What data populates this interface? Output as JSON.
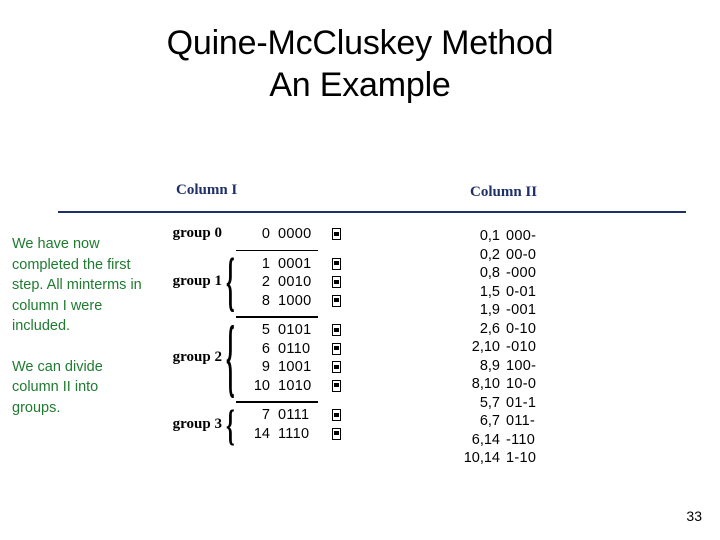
{
  "slide": {
    "title_line1": "Quine-McCluskey Method",
    "title_line2": "An Example",
    "page_number": "33"
  },
  "commentary": {
    "paragraph1": "We have now completed the first step. All minterms in column I were included.",
    "paragraph2": "We can divide column II into groups.",
    "color": "#1E7B30"
  },
  "headers": {
    "column1": "Column I",
    "column2": "Column II",
    "color": "#1F3068"
  },
  "column1": {
    "groups": [
      {
        "label": "group 0",
        "rows": [
          {
            "minterm": "0",
            "bits": "0000",
            "mark": "check-box-icon"
          }
        ]
      },
      {
        "label": "group 1",
        "rows": [
          {
            "minterm": "1",
            "bits": "0001",
            "mark": "check-box-icon"
          },
          {
            "minterm": "2",
            "bits": "0010",
            "mark": "check-box-icon"
          },
          {
            "minterm": "8",
            "bits": "1000",
            "mark": "check-box-icon"
          }
        ]
      },
      {
        "label": "group 2",
        "rows": [
          {
            "minterm": "5",
            "bits": "0101",
            "mark": "check-box-icon"
          },
          {
            "minterm": "6",
            "bits": "0110",
            "mark": "check-box-icon"
          },
          {
            "minterm": "9",
            "bits": "1001",
            "mark": "check-box-icon"
          },
          {
            "minterm": "10",
            "bits": "1010",
            "mark": "check-box-icon"
          }
        ]
      },
      {
        "label": "group 3",
        "rows": [
          {
            "minterm": "7",
            "bits": "0111",
            "mark": "check-box-icon"
          },
          {
            "minterm": "14",
            "bits": "1110",
            "mark": "check-box-icon"
          }
        ]
      }
    ]
  },
  "column2": {
    "rows": [
      {
        "pair": "0,1",
        "bits": "000-"
      },
      {
        "pair": "0,2",
        "bits": "00-0"
      },
      {
        "pair": "0,8",
        "bits": "-000"
      },
      {
        "pair": "1,5",
        "bits": "0-01"
      },
      {
        "pair": "1,9",
        "bits": "-001"
      },
      {
        "pair": "2,6",
        "bits": "0-10"
      },
      {
        "pair": "2,10",
        "bits": "-010"
      },
      {
        "pair": "8,9",
        "bits": "100-"
      },
      {
        "pair": "8,10",
        "bits": "10-0"
      },
      {
        "pair": "5,7",
        "bits": "01-1"
      },
      {
        "pair": "6,7",
        "bits": "011-"
      },
      {
        "pair": "6,14",
        "bits": "-110"
      },
      {
        "pair": "10,14",
        "bits": "1-10"
      }
    ]
  }
}
